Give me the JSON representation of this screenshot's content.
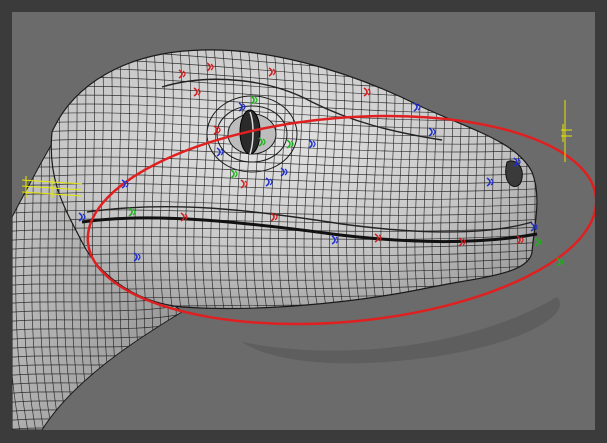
{
  "viewport": {
    "background_color": "#6b6b6b",
    "frame_color": "#3b3b3b"
  },
  "model": {
    "subject": "dinosaur-head-wireframe",
    "surface_color": "#c9c9c9",
    "wire_color": "#1a1a1a",
    "shadow_color": "#575757"
  },
  "rig_controls": {
    "selection_ellipse_color": "#e02020",
    "handle_colors": {
      "red": "#d21c1c",
      "blue": "#2030d0",
      "green": "#18b418",
      "yellow": "#e6e600"
    }
  }
}
